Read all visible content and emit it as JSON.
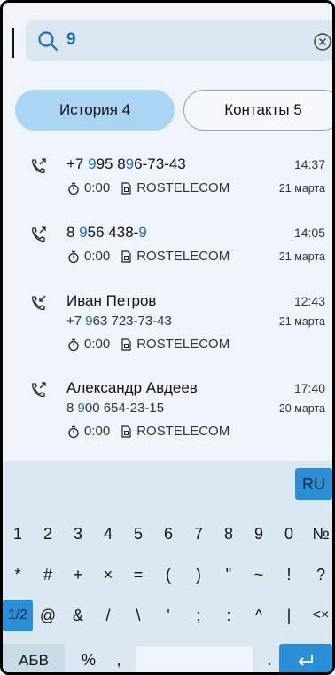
{
  "search": {
    "query": "9"
  },
  "tabs": {
    "history_label": "История 4",
    "contacts_label": "Контакты 5"
  },
  "calls": [
    {
      "name_parts": [
        "+7 ",
        "9",
        "95 8",
        "9",
        "6-73-43"
      ],
      "number": "",
      "time": "14:37",
      "duration": "0:00",
      "operator": "ROSTELECOM",
      "date": "21 марта",
      "direction": "outgoing"
    },
    {
      "name_parts": [
        "8 ",
        "9",
        "56 438-",
        "9",
        ""
      ],
      "number": "",
      "time": "14:05",
      "duration": "0:00",
      "operator": "ROSTELECOM",
      "date": "21 марта",
      "direction": "outgoing"
    },
    {
      "name": "Иван Петров",
      "number_parts": [
        "+7 ",
        "9",
        "63 723-73-43"
      ],
      "time": "12:43",
      "duration": "0:00",
      "operator": "ROSTELECOM",
      "date": "21 марта",
      "direction": "incoming"
    },
    {
      "name": "Александр Авдеев",
      "number_parts": [
        "8 ",
        "9",
        "00 654-23-15"
      ],
      "time": "17:40",
      "duration": "0:00",
      "operator": "ROSTELECOM",
      "date": "20 марта",
      "direction": "outgoing"
    }
  ],
  "keyboard": {
    "lang": "RU",
    "row1": [
      "1",
      "2",
      "3",
      "4",
      "5",
      "6",
      "7",
      "8",
      "9",
      "0",
      "№"
    ],
    "row2": [
      "*",
      "#",
      "+",
      "×",
      "=",
      "(",
      ")",
      "\"",
      "~",
      "!",
      "?"
    ],
    "row3": [
      "1/2",
      "@",
      "&",
      "/",
      "\\",
      "'",
      ";",
      ":",
      "^",
      "|",
      "<×"
    ],
    "abc_label": "АБВ",
    "row4_keys": [
      "%",
      ",",
      "."
    ]
  },
  "colors": {
    "accent": "#1f6fae",
    "tab_active": "#a9d4f2",
    "key_active": "#2a8fd6"
  }
}
